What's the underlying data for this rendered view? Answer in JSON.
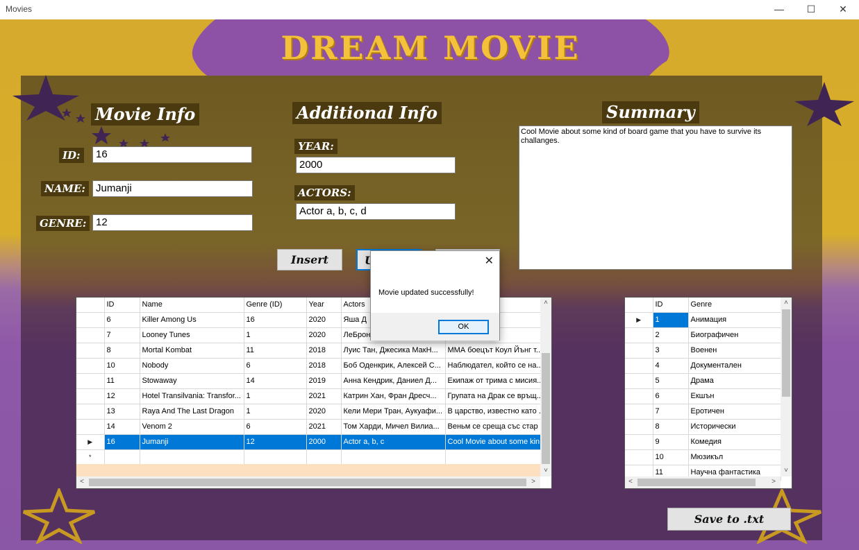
{
  "window": {
    "title": "Movies",
    "min_icon": "minimize-icon",
    "max_icon": "maximize-icon",
    "close_icon": "close-icon"
  },
  "banner": {
    "title": "DREAM MOVIE"
  },
  "sections": {
    "movie_info": "Movie Info",
    "additional_info": "Additional Info",
    "summary": "Summary"
  },
  "fields": {
    "id": {
      "label": "ID:",
      "value": "16"
    },
    "name": {
      "label": "NAME:",
      "value": "Jumanji"
    },
    "genre": {
      "label": "GENRE:",
      "value": "12"
    },
    "year": {
      "label": "YEAR:",
      "value": "2000"
    },
    "actors": {
      "label": "ACTORS:",
      "value": "Actor a, b, c, d"
    },
    "summary": {
      "value": "Cool Movie about some kind of board game that you have to survive its challanges."
    }
  },
  "buttons": {
    "insert": "Insert",
    "update_partial": "U",
    "save": "Save to .txt"
  },
  "movies_grid": {
    "columns": [
      "ID",
      "Name",
      "Genre (ID)",
      "Year",
      "Actors",
      ""
    ],
    "rows": [
      {
        "id": "6",
        "name": "Killer Among Us",
        "genre": "16",
        "year": "2020",
        "actors": "Яша Д",
        "summary": "ена новобр."
      },
      {
        "id": "7",
        "name": "Looney Tunes",
        "genre": "1",
        "year": "2020",
        "actors": "ЛеБрон",
        "summary": "ВА – ЛеБро"
      },
      {
        "id": "8",
        "name": "Mortal Kombat",
        "genre": "11",
        "year": "2018",
        "actors": "Луис Тан, Джесика МакН...",
        "summary": "ММА боецът Коул Йънг т..."
      },
      {
        "id": "10",
        "name": "Nobody",
        "genre": "6",
        "year": "2018",
        "actors": "Боб Оденкрик, Алексей С...",
        "summary": "Наблюдател, който се на..."
      },
      {
        "id": "11",
        "name": "Stowaway",
        "genre": "14",
        "year": "2019",
        "actors": "Анна Кендрик, Даниел Д...",
        "summary": "Екипаж от трима с мисия..."
      },
      {
        "id": "12",
        "name": "Hotel Transilvania: Transfor...",
        "genre": "1",
        "year": "2021",
        "actors": "Катрин Хан, Фран Дресч...",
        "summary": "Групата на Драк се връщ..."
      },
      {
        "id": "13",
        "name": "Raya And The Last Dragon",
        "genre": "1",
        "year": "2020",
        "actors": "Кели Мери Тран, Аукуафи...",
        "summary": "В царство, известно като ..."
      },
      {
        "id": "14",
        "name": "Venom 2",
        "genre": "6",
        "year": "2021",
        "actors": "Том Харди, Мичел Вилиа...",
        "summary": "Веньм се среща със стар"
      },
      {
        "id": "16",
        "name": "Jumanji",
        "genre": "12",
        "year": "2000",
        "actors": "Actor a, b, c",
        "summary": "Cool Movie about some kin..."
      }
    ],
    "new_row_marker": "*",
    "current_row_marker": "▶"
  },
  "genres_grid": {
    "columns": [
      "ID",
      "Genre"
    ],
    "rows": [
      {
        "id": "1",
        "genre": "Анимация"
      },
      {
        "id": "2",
        "genre": "Биографичен"
      },
      {
        "id": "3",
        "genre": "Военен"
      },
      {
        "id": "4",
        "genre": "Документален"
      },
      {
        "id": "5",
        "genre": "Драма"
      },
      {
        "id": "6",
        "genre": "Екшън"
      },
      {
        "id": "7",
        "genre": "Еротичен"
      },
      {
        "id": "8",
        "genre": "Исторически"
      },
      {
        "id": "9",
        "genre": "Комедия"
      },
      {
        "id": "10",
        "genre": "Мюзикъл"
      },
      {
        "id": "11",
        "genre": "Научна фантастика"
      }
    ],
    "current_row_marker": "▶"
  },
  "dialog": {
    "message": "Movie updated successfully!",
    "ok": "OK",
    "close": "✕"
  },
  "colors": {
    "gold": "#d6aa2c",
    "purple": "#8f58a8",
    "banner_purple": "#8a50a0",
    "selection": "#0078d7",
    "label_bg": "#4b3a10"
  }
}
